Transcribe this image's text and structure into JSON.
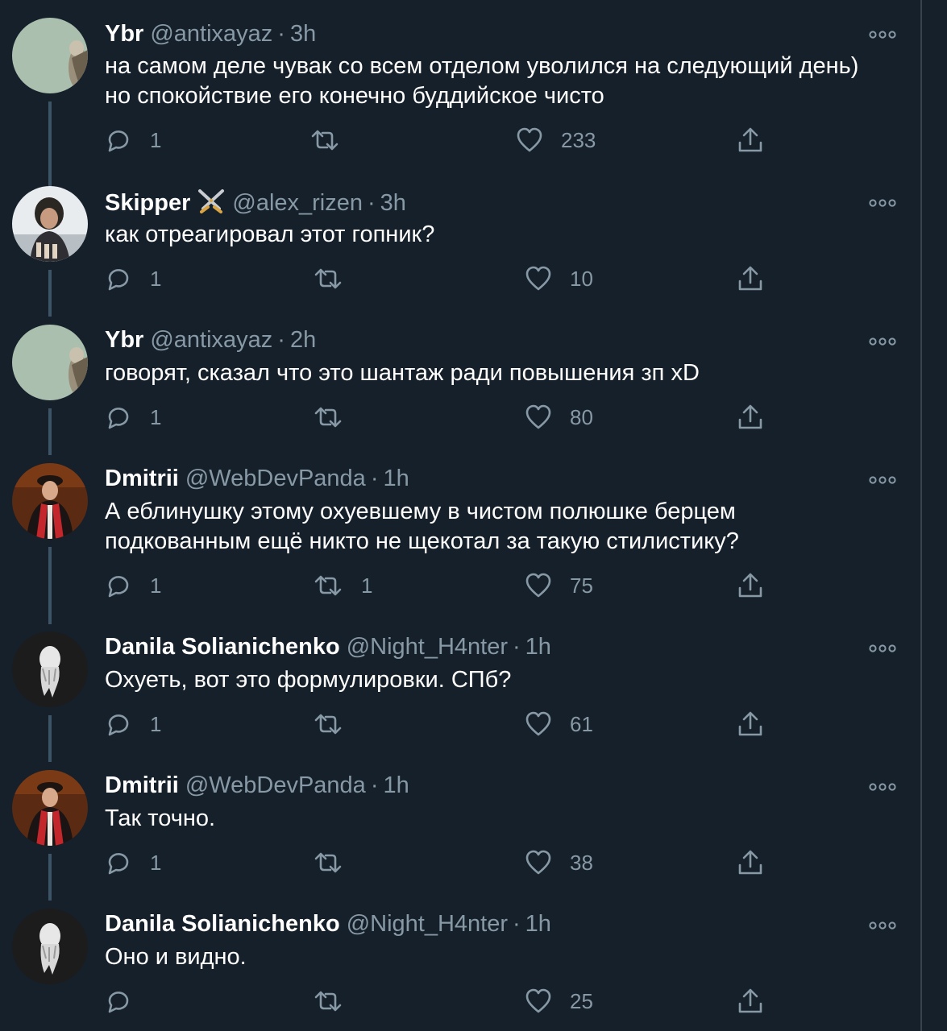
{
  "colors": {
    "background": "#15202b",
    "text": "#ffffff",
    "secondary_text": "#8899a6",
    "thread_line": "#3d5466"
  },
  "tweets": [
    {
      "name": "Ybr",
      "handle": "@antixayaz",
      "separator": "·",
      "time": "3h",
      "lines": [
        "на самом деле чувак со всем отделом уволился на следующий день)",
        "но спокойствие его конечно буддийское чисто"
      ],
      "reply_count": "1",
      "retweet_count": "",
      "like_count": "233",
      "avatar_icon": "owl-avatar-icon"
    },
    {
      "name": "Skipper",
      "badge_icon": "crossed-swords-icon",
      "handle": "@alex_rizen",
      "separator": "·",
      "time": "3h",
      "lines": [
        "как отреагировал этот гопник?"
      ],
      "reply_count": "1",
      "retweet_count": "",
      "like_count": "10",
      "avatar_icon": "person-photo-avatar-icon"
    },
    {
      "name": "Ybr",
      "handle": "@antixayaz",
      "separator": "·",
      "time": "2h",
      "lines": [
        "говорят, сказал что это шантаж ради повышения зп xD"
      ],
      "reply_count": "1",
      "retweet_count": "",
      "like_count": "80",
      "avatar_icon": "owl-avatar-icon"
    },
    {
      "name": "Dmitrii",
      "handle": "@WebDevPanda",
      "separator": "·",
      "time": "1h",
      "lines": [
        "А еблинушку этому охуевшему в чистом полюшке берцем",
        "подкованным ещё никто не щекотал за такую стилистику?"
      ],
      "reply_count": "1",
      "retweet_count": "1",
      "like_count": "75",
      "avatar_icon": "graduation-robe-avatar-icon"
    },
    {
      "name": "Danila Solianichenko",
      "handle": "@Night_H4nter",
      "separator": "·",
      "time": "1h",
      "lines": [
        "Охуеть, вот это формулировки. СПб?"
      ],
      "reply_count": "1",
      "retweet_count": "",
      "like_count": "61",
      "avatar_icon": "white-figure-avatar-icon"
    },
    {
      "name": "Dmitrii",
      "handle": "@WebDevPanda",
      "separator": "·",
      "time": "1h",
      "lines": [
        "Так точно."
      ],
      "reply_count": "1",
      "retweet_count": "",
      "like_count": "38",
      "avatar_icon": "graduation-robe-avatar-icon"
    },
    {
      "name": "Danila Solianichenko",
      "handle": "@Night_H4nter",
      "separator": "·",
      "time": "1h",
      "lines": [
        "Оно и видно."
      ],
      "reply_count": "",
      "retweet_count": "",
      "like_count": "25",
      "avatar_icon": "white-figure-avatar-icon"
    }
  ]
}
